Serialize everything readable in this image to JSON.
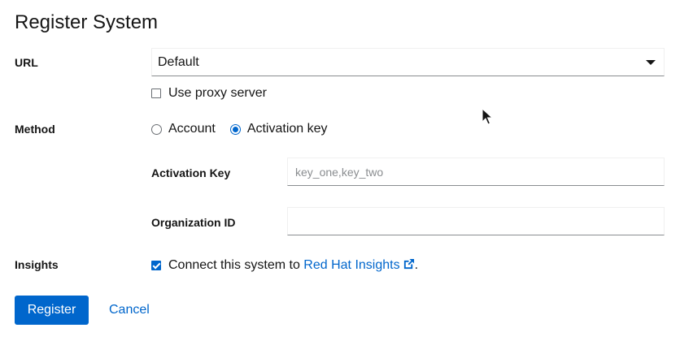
{
  "dialog": {
    "title": "Register System"
  },
  "url": {
    "label": "URL",
    "selected": "Default"
  },
  "proxy": {
    "label": "Use proxy server",
    "checked": false
  },
  "method": {
    "label": "Method",
    "options": [
      {
        "label": "Account",
        "checked": false
      },
      {
        "label": "Activation key",
        "checked": true
      }
    ]
  },
  "activation_key": {
    "label": "Activation Key",
    "value": "",
    "placeholder": "key_one,key_two"
  },
  "organization_id": {
    "label": "Organization ID",
    "value": "",
    "placeholder": ""
  },
  "insights": {
    "label": "Insights",
    "checked": true,
    "text_before": "Connect this system to ",
    "link_text": "Red Hat Insights",
    "text_after": "."
  },
  "actions": {
    "register_label": "Register",
    "cancel_label": "Cancel"
  },
  "icons": {
    "dropdown": "caret-down-icon",
    "external": "external-link-icon",
    "cursor": "mouse-pointer-icon"
  },
  "colors": {
    "primary": "#0066cc",
    "text": "#151515",
    "placeholder": "#8a8d90"
  }
}
